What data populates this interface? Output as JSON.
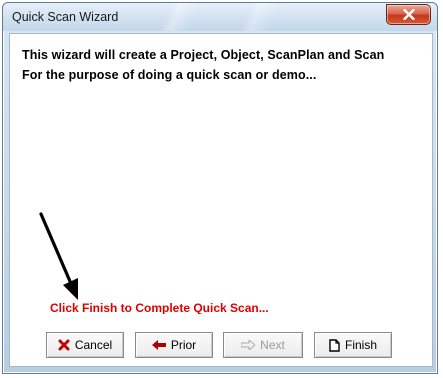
{
  "window": {
    "title": "Quick Scan Wizard",
    "close_icon": "close-x-icon"
  },
  "body": {
    "line1": "This wizard will create a Project, Object, ScanPlan and Scan",
    "line2": "For the purpose of doing a quick scan or demo...",
    "finish_message": "Click Finish to Complete Quick Scan..."
  },
  "buttons": {
    "cancel": {
      "label": "Cancel",
      "icon": "red-x-icon"
    },
    "prior": {
      "label": "Prior",
      "icon": "left-arrow-icon"
    },
    "next": {
      "label": "Next",
      "icon": "right-arrow-icon",
      "enabled": false
    },
    "finish": {
      "label": "Finish",
      "icon": "document-icon"
    }
  },
  "colors": {
    "finish_message": "#e00000",
    "close_button": "#c4381b"
  }
}
